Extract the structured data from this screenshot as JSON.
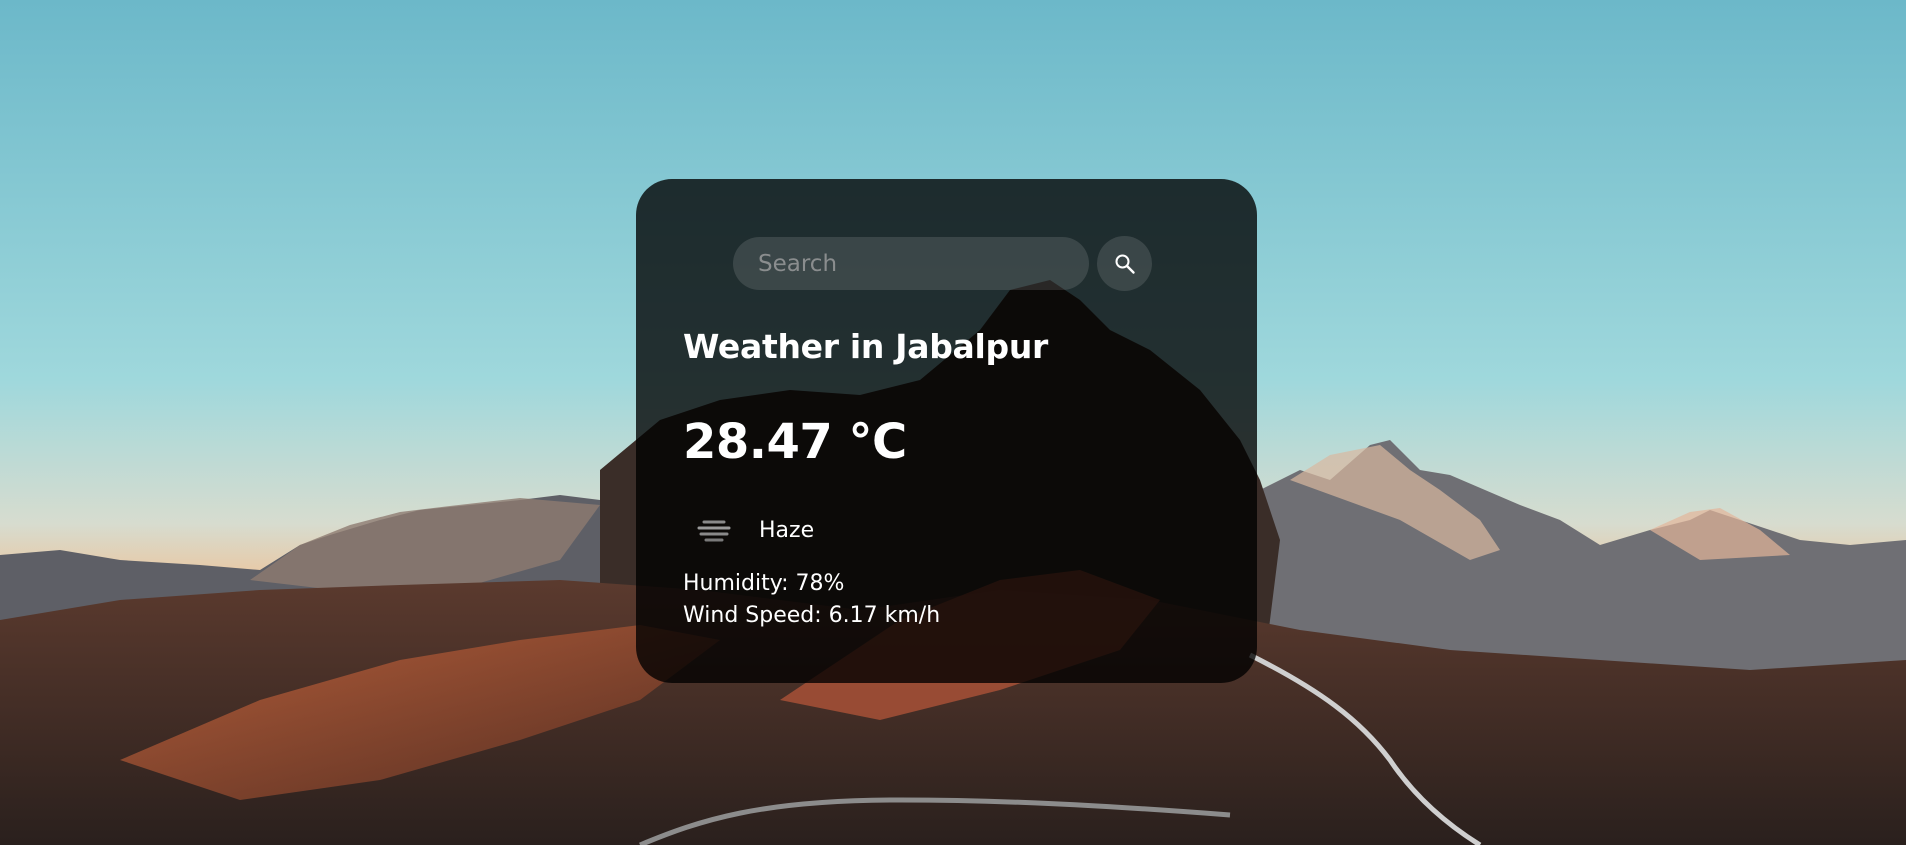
{
  "search": {
    "placeholder": "Search",
    "value": "",
    "button_icon": "search-icon"
  },
  "weather": {
    "title": "Weather in Jabalpur",
    "temperature": "28.47 °C",
    "condition_icon": "haze-icon",
    "condition": "Haze",
    "humidity": "Humidity: 78%",
    "wind_speed": "Wind Speed: 6.17 km/h"
  },
  "colors": {
    "card_background": "rgba(0,0,0,0.78)",
    "text": "#ffffff",
    "placeholder": "#8a8d8e"
  }
}
